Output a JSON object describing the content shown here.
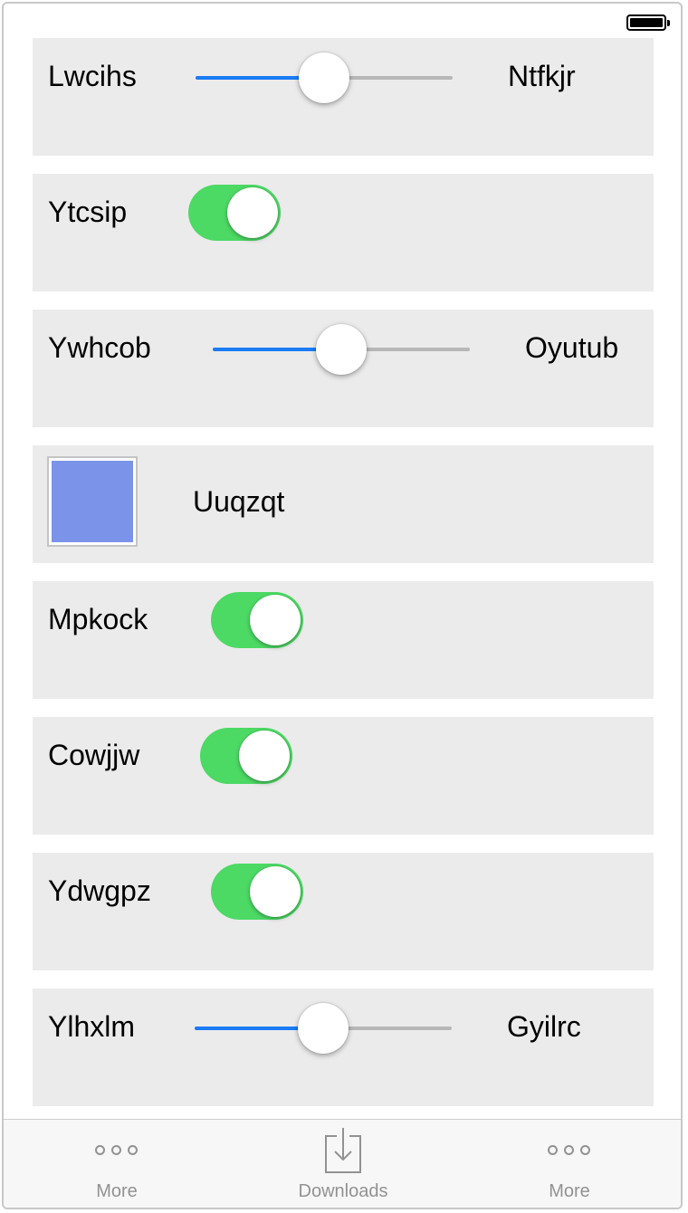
{
  "rows": [
    {
      "type": "slider",
      "label": "Lwcihs",
      "right_label": "Ntfkjr",
      "value": 0.5
    },
    {
      "type": "toggle",
      "label": "Ytcsip",
      "on": true
    },
    {
      "type": "slider",
      "label": "Ywhcob",
      "right_label": "Oyutub",
      "value": 0.5
    },
    {
      "type": "color",
      "label": "Uuqzqt",
      "color": "#7b93e8"
    },
    {
      "type": "toggle",
      "label": "Mpkock",
      "on": true
    },
    {
      "type": "toggle",
      "label": "Cowjjw",
      "on": true
    },
    {
      "type": "toggle",
      "label": "Ydwgpz",
      "on": true
    },
    {
      "type": "slider",
      "label": "Ylhxlm",
      "right_label": "Gyilrc",
      "value": 0.5
    }
  ],
  "tab_bar": {
    "tabs": [
      {
        "label": "More",
        "icon": "more-icon"
      },
      {
        "label": "Downloads",
        "icon": "download-icon"
      },
      {
        "label": "More",
        "icon": "more-icon"
      }
    ]
  },
  "colors": {
    "row_background": "#ebebeb",
    "toggle_on": "#4cd964",
    "slider_min_track": "#1a7cf5",
    "slider_max_track": "#b7b7b7",
    "tab_label": "#929292"
  }
}
